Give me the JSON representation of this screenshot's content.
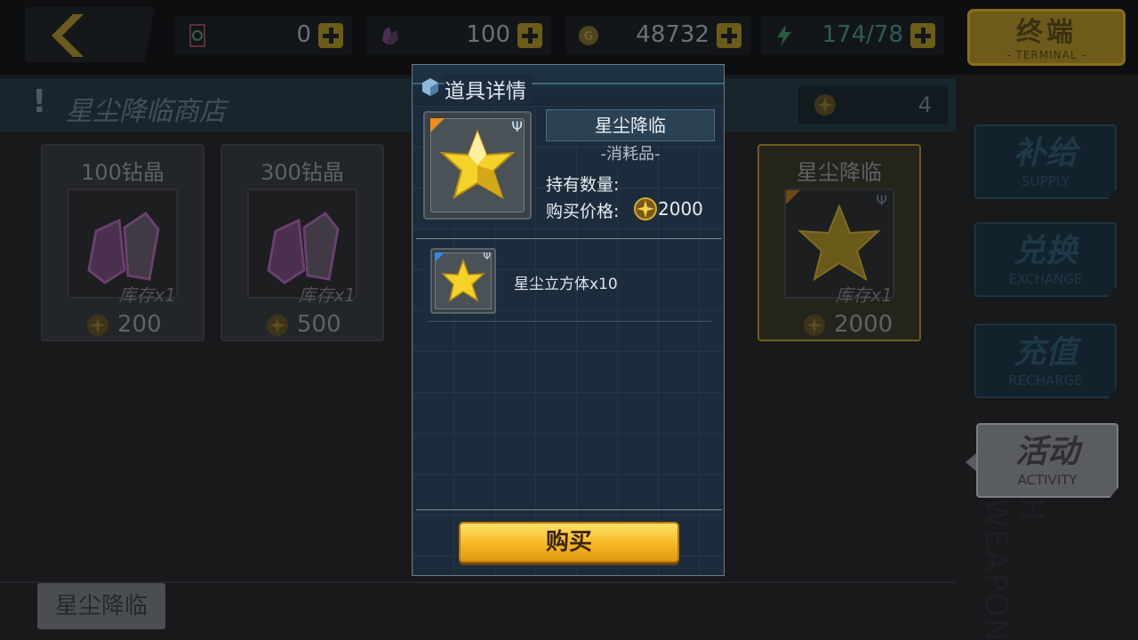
{
  "resources": [
    {
      "icon": "qr-ticket-icon",
      "value": "0"
    },
    {
      "icon": "crystal-icon",
      "value": "100"
    },
    {
      "icon": "gold-coin-icon",
      "value": "48732"
    },
    {
      "icon": "energy-icon",
      "value": "174/78"
    }
  ],
  "terminal": {
    "cn": "终端",
    "en": "- TERMINAL -"
  },
  "shop": {
    "title": "星尘降临商店",
    "currency_count": "4"
  },
  "cards": [
    {
      "name": "100钻晶",
      "stock": "库存x1",
      "price": "200",
      "icon": "crystal-icon"
    },
    {
      "name": "300钻晶",
      "stock": "库存x1",
      "price": "500",
      "icon": "crystal-icon"
    },
    {
      "name": "星尘降临",
      "stock": "库存x1",
      "price": "2000",
      "icon": "star-tetrahedron-icon"
    }
  ],
  "side_menu": [
    {
      "cn": "补给",
      "en": "SUPPLY"
    },
    {
      "cn": "兑换",
      "en": "EXCHANGE"
    },
    {
      "cn": "充值",
      "en": "RECHARGE"
    },
    {
      "cn": "活动",
      "en": "ACTIVITY"
    }
  ],
  "side_vertical_text": "H WEAPON",
  "bottom_tab": "星尘降临",
  "modal": {
    "title": "道具详情",
    "item_name": "星尘降临",
    "item_type": "-消耗品-",
    "own_label": "持有数量:",
    "price_label": "购买价格:",
    "price": "2000",
    "contents_label": "星尘立方体x10",
    "buy_label": "购买"
  },
  "colors": {
    "accent_gold": "#f6b723",
    "panel": "#1c2c3c",
    "rarity_orange": "#f08c18",
    "rarity_blue": "#3a86e0"
  }
}
